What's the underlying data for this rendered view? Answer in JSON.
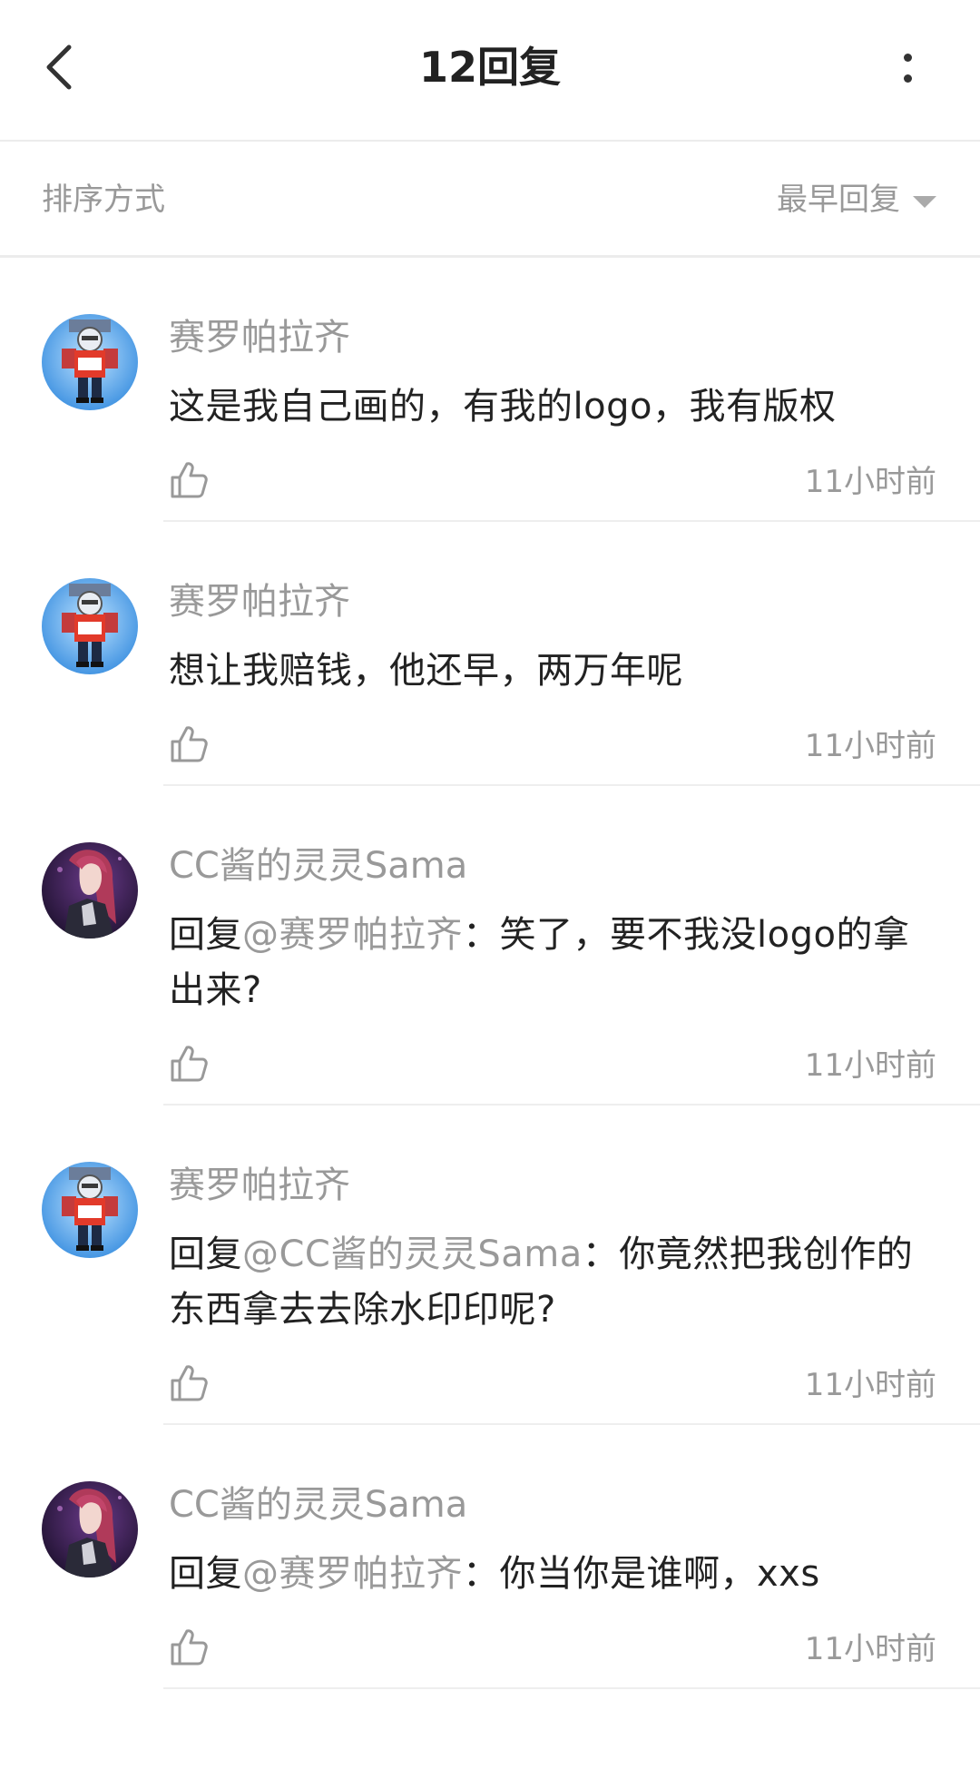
{
  "header": {
    "back_icon": "chevron-left-icon",
    "title": "12回复",
    "more_icon": "more-vertical-icon"
  },
  "sort": {
    "label": "排序方式",
    "selected": "最早回复",
    "caret_icon": "caret-down-icon"
  },
  "comments": [
    {
      "username": "赛罗帕拉齐",
      "avatar": "robot-avatar",
      "reply_prefix": "",
      "mention": "",
      "text": "这是我自己画的，有我的logo，我有版权",
      "time": "11小时前",
      "like_icon": "thumbs-up-icon"
    },
    {
      "username": "赛罗帕拉齐",
      "avatar": "robot-avatar",
      "reply_prefix": "",
      "mention": "",
      "text": "想让我赔钱，他还早，两万年呢",
      "time": "11小时前",
      "like_icon": "thumbs-up-icon"
    },
    {
      "username": "CC酱的灵灵Sama",
      "avatar": "anime-girl-avatar",
      "reply_prefix": "回复",
      "mention": "@赛罗帕拉齐",
      "text": "：笑了，要不我没logo的拿出来?",
      "time": "11小时前",
      "like_icon": "thumbs-up-icon"
    },
    {
      "username": "赛罗帕拉齐",
      "avatar": "robot-avatar",
      "reply_prefix": "回复",
      "mention": "@CC酱的灵灵Sama",
      "text": "：你竟然把我创作的东西拿去去除水印印呢?",
      "time": "11小时前",
      "like_icon": "thumbs-up-icon"
    },
    {
      "username": "CC酱的灵灵Sama",
      "avatar": "anime-girl-avatar",
      "reply_prefix": "回复",
      "mention": "@赛罗帕拉齐",
      "text": "：你当你是谁啊，xxs",
      "time": "11小时前",
      "like_icon": "thumbs-up-icon"
    }
  ],
  "colors": {
    "text_primary": "#222222",
    "text_secondary": "#999999",
    "divider": "#eeeeee"
  }
}
